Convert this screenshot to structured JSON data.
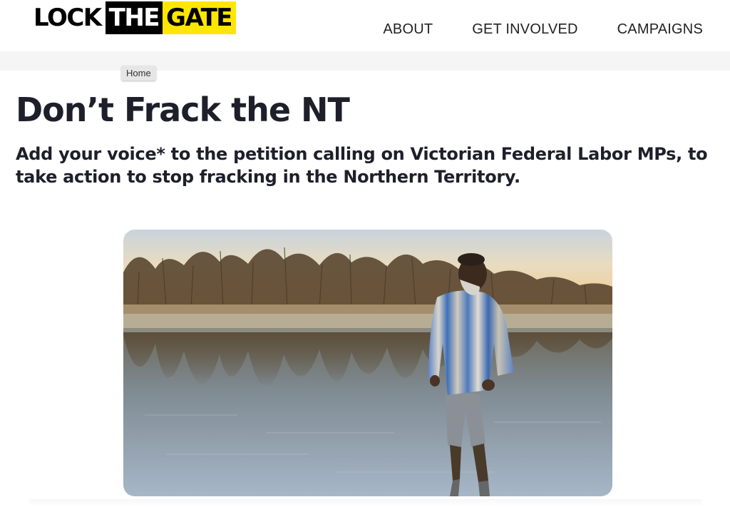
{
  "logo": {
    "part1": "LOCK",
    "part2": "THE",
    "part3": "GATE",
    "accent_color": "#ffe600",
    "dark_color": "#000000"
  },
  "nav": {
    "items": [
      {
        "label": "ABOUT"
      },
      {
        "label": "GET INVOLVED"
      },
      {
        "label": "CAMPAIGNS"
      }
    ]
  },
  "breadcrumb": {
    "home": "Home"
  },
  "main": {
    "title": "Don’t Frack the NT",
    "subtitle": "Add your voice* to the petition calling on Victorian Federal Labor MPs, to take action to stop fracking in the Northern Territory."
  },
  "colors": {
    "text": "#1f1f2b",
    "subbar": "#f5f5f5"
  }
}
